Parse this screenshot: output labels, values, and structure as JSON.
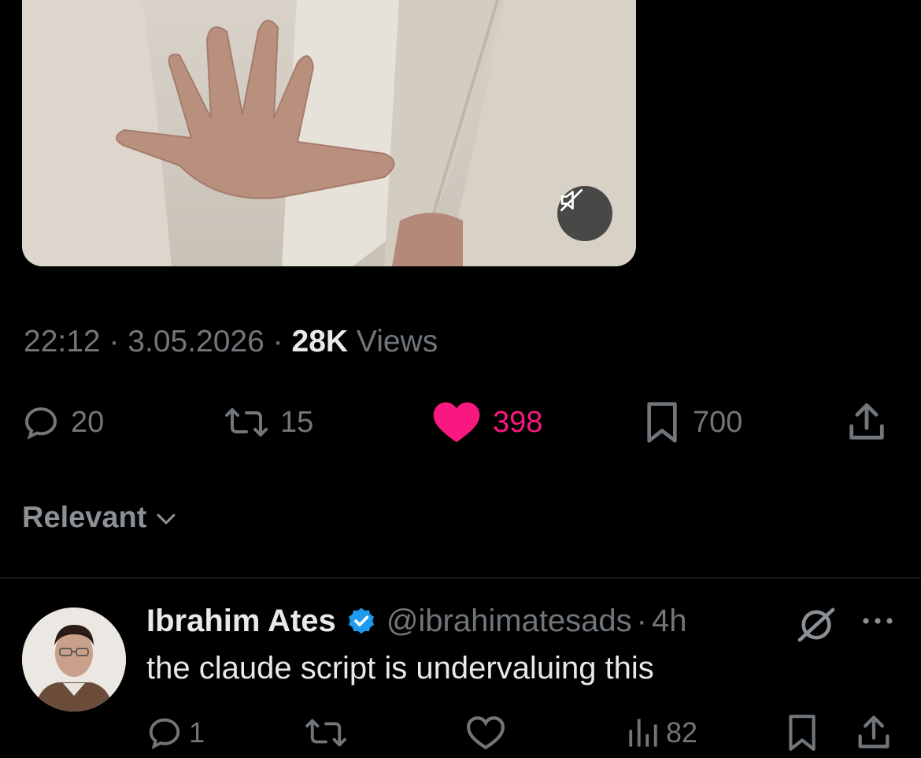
{
  "tweet": {
    "time": "22:12",
    "sep1": "·",
    "date": "3.05.2026",
    "sep2": "·",
    "views_count": "28K",
    "views_label": "Views"
  },
  "actions": {
    "replies": "20",
    "reposts": "15",
    "likes": "398",
    "bookmarks": "700"
  },
  "sort": {
    "label": "Relevant"
  },
  "reply": {
    "name": "Ibrahim Ates",
    "handle": "@ibrahimatesads",
    "sep": "·",
    "age": "4h",
    "text": "the claude script is undervaluing this",
    "replies": "1",
    "reposts": "",
    "likes": "",
    "views": "82"
  },
  "colors": {
    "like_active": "#f91880",
    "verified": "#1d9bf0",
    "muted_text": "#71767b",
    "divider": "#2f3336"
  },
  "icons": [
    "mute-icon",
    "reply-icon",
    "repost-icon",
    "heart-icon",
    "bookmark-icon",
    "share-icon",
    "chevron-down-icon",
    "verified-badge-icon",
    "grok-icon",
    "more-icon",
    "views-icon"
  ]
}
